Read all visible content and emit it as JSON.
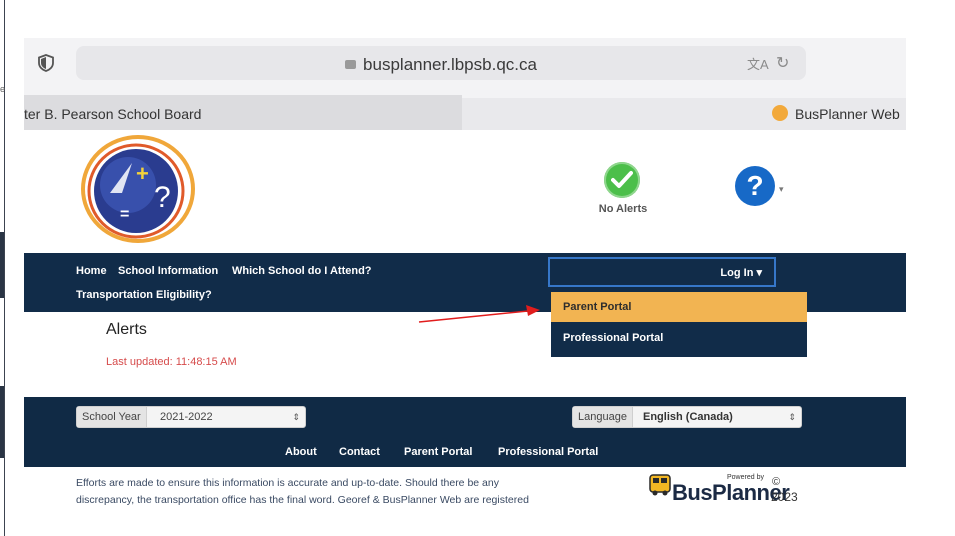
{
  "browser": {
    "url": "busplanner.lbpsb.qc.ca",
    "tabs": [
      {
        "label": "ter B. Pearson School Board"
      },
      {
        "label": "BusPlanner Web"
      }
    ],
    "side_fragment": "e"
  },
  "header": {
    "alerts_status": "No Alerts",
    "help_glyph": "?",
    "logo_symbols": {
      "plus": "+",
      "question": "?",
      "equals": "="
    }
  },
  "nav": {
    "links": [
      "Home",
      "School Information",
      "Which School do I Attend?",
      "Transportation Eligibility?"
    ],
    "login_label": "Log In ▾",
    "dropdown": [
      "Parent Portal",
      "Professional Portal"
    ]
  },
  "alerts": {
    "title": "Alerts",
    "last_updated": "Last updated: 11:48:15 AM"
  },
  "footer": {
    "school_year_label": "School Year",
    "school_year_value": "2021-2022",
    "language_label": "Language",
    "language_value": "English (Canada)",
    "links": [
      "About",
      "Contact",
      "Parent Portal",
      "Professional Portal"
    ],
    "disclaimer_line1": "Efforts are made to ensure this information is accurate and up-to-date. Should there be any",
    "disclaimer_line2": "discrepancy, the transportation office has the final word. Georef & BusPlanner Web are registered",
    "powered_by": "Powered by",
    "brand": "BusPlanner",
    "copyright": "©",
    "year": "2023"
  },
  "colors": {
    "navbar": "#112c49",
    "dropdown_highlight": "#f2b452",
    "help_blue": "#1769c7",
    "ok_green": "#4cbf4a",
    "alert_red": "#d64b4b",
    "arrow_red": "#e11d1d"
  },
  "icons": [
    "shield-icon",
    "lock-icon",
    "translate-icon",
    "reload-icon",
    "busplanner-tab-icon",
    "check-icon",
    "help-icon",
    "bus-icon"
  ]
}
